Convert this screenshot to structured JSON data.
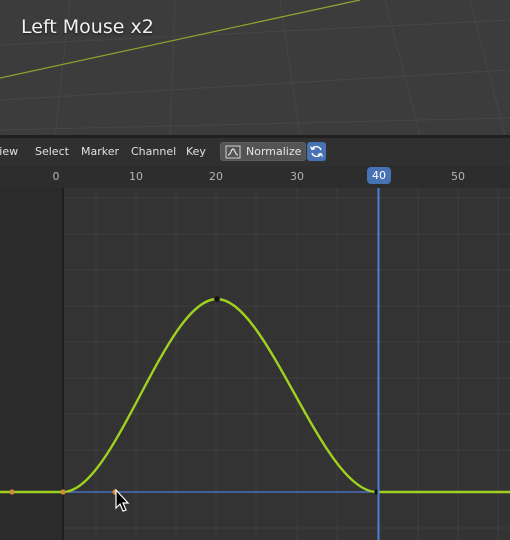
{
  "viewport": {
    "overlay_text": "Left Mouse x2"
  },
  "header": {
    "menu": [
      "View",
      "Select",
      "Marker",
      "Channel",
      "Key"
    ],
    "normalize_label": "Normalize",
    "normalize_toggle_active": true
  },
  "ruler": {
    "ticks": [
      "0",
      "10",
      "20",
      "30",
      "40",
      "50"
    ],
    "current_frame": "40"
  },
  "colors": {
    "curve": "#9fd21f",
    "playhead": "#4d7fd6",
    "accent": "#4772b3",
    "keyframe": "#d18a3a"
  },
  "icons": [
    "normalize-curve-icon",
    "refresh-toggle-icon",
    "mouse-cursor-icon"
  ]
}
